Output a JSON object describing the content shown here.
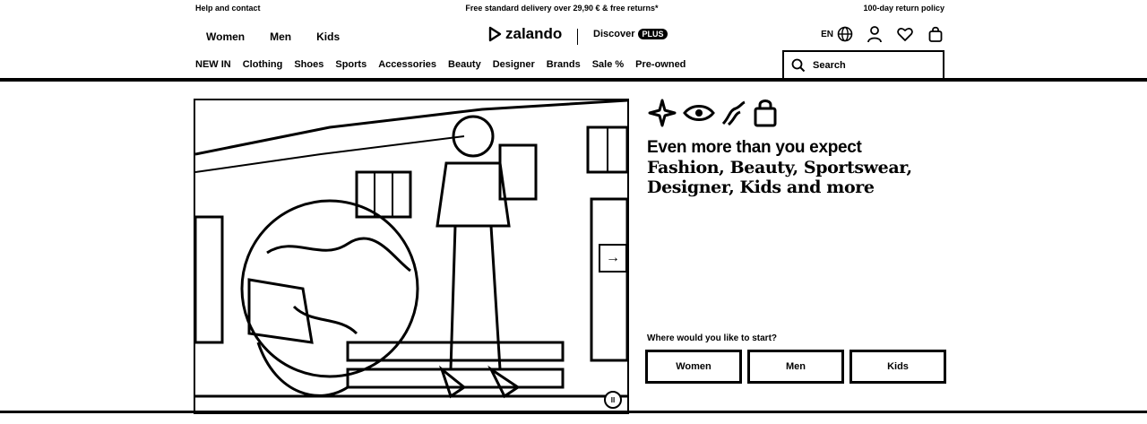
{
  "topbar": {
    "help": "Help and contact",
    "delivery": "Free standard delivery over 29,90 € & free returns*",
    "returns": "100-day return policy"
  },
  "header": {
    "gender_nav": [
      "Women",
      "Men",
      "Kids"
    ],
    "brand": "zalando",
    "discover": "Discover",
    "plus": "PLUS",
    "language": "EN"
  },
  "category_nav": [
    "NEW IN",
    "Clothing",
    "Shoes",
    "Sports",
    "Accessories",
    "Beauty",
    "Designer",
    "Brands",
    "Sale %",
    "Pre-owned"
  ],
  "search": {
    "placeholder": "Search"
  },
  "promo": {
    "title": "Even more than you expect",
    "subtitle_line1": "Fashion, Beauty, Sportswear,",
    "subtitle_line2": "Designer, Kids and more",
    "question": "Where would you like to start?",
    "buttons": [
      "Women",
      "Men",
      "Kids"
    ]
  },
  "hero": {
    "next_label": "→",
    "pause_label": "II"
  },
  "icons": [
    "globe-icon",
    "user-icon",
    "heart-icon",
    "bag-icon",
    "search-icon",
    "arrow-right-icon",
    "pause-icon"
  ]
}
